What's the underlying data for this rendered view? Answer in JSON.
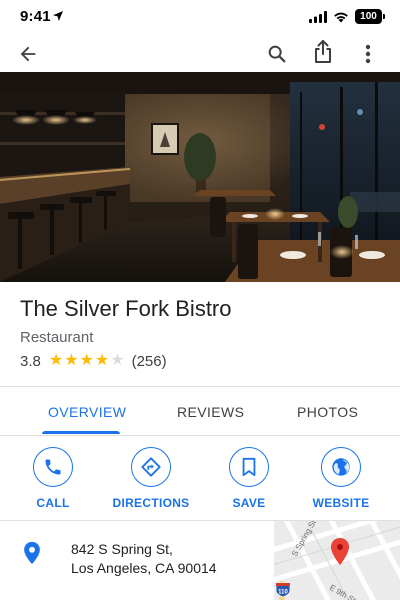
{
  "status_bar": {
    "time": "9:41",
    "battery": "100"
  },
  "app_bar": {
    "back_icon": "arrow-left-icon",
    "search_icon": "search-icon",
    "share_icon": "share-icon",
    "more_icon": "more-vert-icon"
  },
  "place": {
    "name": "The Silver Fork Bistro",
    "category": "Restaurant",
    "rating": "3.8",
    "rating_stars": 3.8,
    "review_count": "(256)"
  },
  "tabs": [
    {
      "label": "OVERVIEW",
      "active": true
    },
    {
      "label": "REVIEWS",
      "active": false
    },
    {
      "label": "PHOTOS",
      "active": false
    }
  ],
  "actions": [
    {
      "label": "CALL",
      "icon": "phone-icon"
    },
    {
      "label": "DIRECTIONS",
      "icon": "directions-icon"
    },
    {
      "label": "SAVE",
      "icon": "bookmark-icon"
    },
    {
      "label": "WEBSITE",
      "icon": "globe-icon"
    }
  ],
  "address": {
    "line1": "842 S Spring St,",
    "line2": "Los Angeles, CA 90014"
  },
  "map": {
    "street_label_1": "S Spring St",
    "street_label_2": "E 9th St",
    "highway_shield": "110"
  },
  "colors": {
    "accent": "#1a73e8",
    "star": "#fbbc04",
    "map_pin": "#ea4335"
  }
}
